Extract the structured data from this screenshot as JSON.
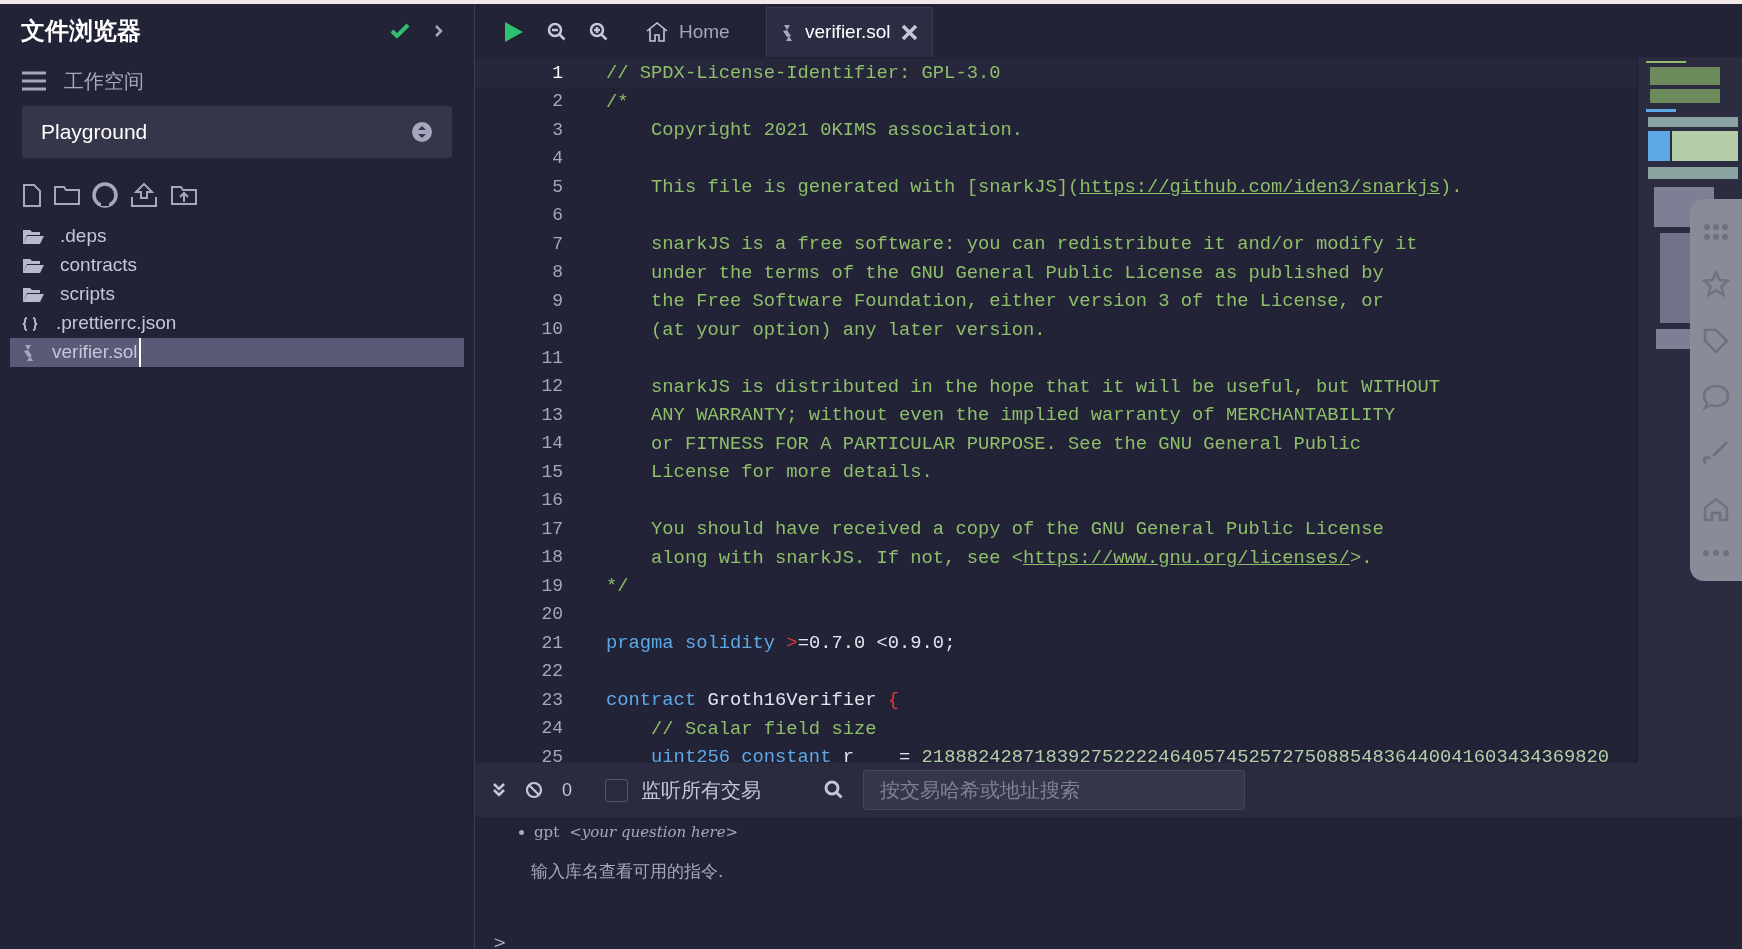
{
  "sidebar": {
    "title": "文件浏览器",
    "workspace_label": "工作空间",
    "workspace_select": {
      "value": "Playground"
    },
    "files": [
      {
        "name": ".deps",
        "kind": "folder",
        "selected": false
      },
      {
        "name": "contracts",
        "kind": "folder",
        "selected": false
      },
      {
        "name": "scripts",
        "kind": "folder",
        "selected": false
      },
      {
        "name": ".prettierrc.json",
        "kind": "json",
        "selected": false
      },
      {
        "name": "verifier.sol",
        "kind": "solidity",
        "selected": true
      }
    ]
  },
  "tabs": [
    {
      "label": "Home",
      "kind": "home",
      "selected": false
    },
    {
      "label": "verifier.sol",
      "kind": "solidity",
      "selected": true
    }
  ],
  "editor": {
    "lines": [
      {
        "number": "1",
        "current": true,
        "segments": [
          {
            "text": "// SPDX-License-Identifier: GPL-3.0",
            "kind": "comment"
          }
        ]
      },
      {
        "number": "2",
        "current": false,
        "segments": [
          {
            "text": "/*",
            "kind": "comment"
          }
        ]
      },
      {
        "number": "3",
        "current": false,
        "segments": [
          {
            "text": "    Copyright 2021 0KIMS association.",
            "kind": "comment"
          }
        ]
      },
      {
        "number": "4",
        "current": false
      },
      {
        "number": "5",
        "current": false,
        "segments": [
          {
            "text": "    This file is generated with [snarkJS](",
            "kind": "comment"
          },
          {
            "text": "https://github.com/iden3/snarkjs",
            "kind": "link"
          },
          {
            "text": ").",
            "kind": "comment"
          }
        ]
      },
      {
        "number": "6",
        "current": false
      },
      {
        "number": "7",
        "current": false,
        "segments": [
          {
            "text": "    snarkJS is a free software: you can redistribute it and/or modify it",
            "kind": "comment"
          }
        ]
      },
      {
        "number": "8",
        "current": false,
        "segments": [
          {
            "text": "    under the terms of the GNU General Public License as published by",
            "kind": "comment"
          }
        ]
      },
      {
        "number": "9",
        "current": false,
        "segments": [
          {
            "text": "    the Free Software Foundation, either version 3 of the License, or",
            "kind": "comment"
          }
        ]
      },
      {
        "number": "10",
        "current": false,
        "segments": [
          {
            "text": "    (at your option) any later version.",
            "kind": "comment"
          }
        ]
      },
      {
        "number": "11",
        "current": false
      },
      {
        "number": "12",
        "current": false,
        "segments": [
          {
            "text": "    snarkJS is distributed in the hope that it will be useful, but WITHOUT",
            "kind": "comment"
          }
        ]
      },
      {
        "number": "13",
        "current": false,
        "segments": [
          {
            "text": "    ANY WARRANTY; without even the implied warranty of MERCHANTABILITY",
            "kind": "comment"
          }
        ]
      },
      {
        "number": "14",
        "current": false,
        "segments": [
          {
            "text": "    or FITNESS FOR A PARTICULAR PURPOSE. See the GNU General Public",
            "kind": "comment"
          }
        ]
      },
      {
        "number": "15",
        "current": false,
        "segments": [
          {
            "text": "    License for more details.",
            "kind": "comment"
          }
        ]
      },
      {
        "number": "16",
        "current": false
      },
      {
        "number": "17",
        "current": false,
        "segments": [
          {
            "text": "    You should have received a copy of the GNU General Public License",
            "kind": "comment"
          }
        ]
      },
      {
        "number": "18",
        "current": false,
        "segments": [
          {
            "text": "    along with snarkJS. If not, see <",
            "kind": "comment"
          },
          {
            "text": "https://www.gnu.org/licenses/",
            "kind": "link"
          },
          {
            "text": ">.",
            "kind": "comment"
          }
        ]
      },
      {
        "number": "19",
        "current": false,
        "segments": [
          {
            "text": "*/",
            "kind": "comment"
          }
        ]
      },
      {
        "number": "20",
        "current": false
      },
      {
        "number": "21",
        "current": false,
        "segments": [
          {
            "text": "pragma solidity ",
            "kind": "keyword"
          },
          {
            "text": ">",
            "kind": "operator"
          },
          {
            "text": "=0.7.0 <0.9.0;",
            "kind": "plain"
          }
        ]
      },
      {
        "number": "22",
        "current": false
      },
      {
        "number": "23",
        "current": false,
        "segments": [
          {
            "text": "contract ",
            "kind": "keyword"
          },
          {
            "text": "Groth16Verifier ",
            "kind": "plain"
          },
          {
            "text": "{",
            "kind": "operator"
          }
        ]
      },
      {
        "number": "24",
        "current": false,
        "segments": [
          {
            "text": "    // Scalar field size",
            "kind": "comment"
          }
        ]
      },
      {
        "number": "25",
        "current": false,
        "segments": [
          {
            "text": "    uint256 constant ",
            "kind": "keyword"
          },
          {
            "text": "r    = ",
            "kind": "plain"
          },
          {
            "text": "2188824287183927522224640574525727508854836440041603434369820",
            "kind": "number"
          }
        ]
      }
    ]
  },
  "terminal": {
    "count": "0",
    "listen": {
      "label": "监听所有交易",
      "checked": false
    },
    "search": {
      "placeholder": "按交易哈希或地址搜索"
    },
    "bullet": {
      "command": "gpt",
      "hint": "<your question here>"
    },
    "message": "输入库名查看可用的指令.",
    "prompt": ">"
  }
}
